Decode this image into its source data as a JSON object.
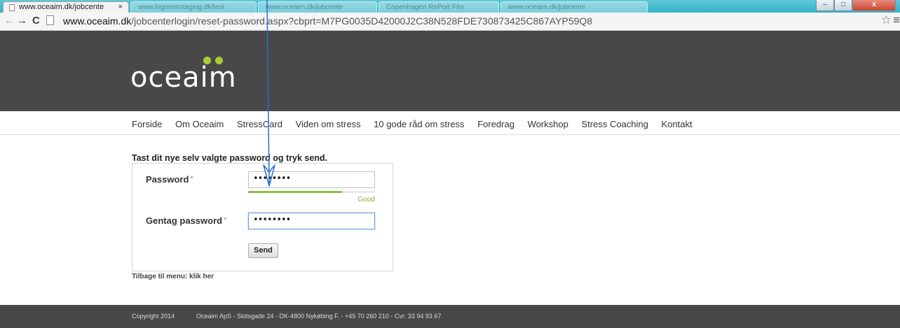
{
  "browser": {
    "active_tab": {
      "title": "www.oceaim.dk/jobcente",
      "close": "×"
    },
    "inactive_tabs": [
      {
        "title": "www.logmeinstaging.dk/test"
      },
      {
        "title": "www.oceaim.dk/jobcente"
      },
      {
        "title": "Copenhagen RePort Fitn"
      },
      {
        "title": "www.oceaim.dk/jobcente"
      }
    ],
    "url_host": "www.oceaim.dk",
    "url_rest": "/jobcenterlogin/reset-password.aspx?cbprt=M7PG0035D42000J2C38N528FDE730873425C867AYP59Q8",
    "window_controls": {
      "minimize": "–",
      "maximize": "□",
      "close": "x"
    },
    "icons": {
      "back": "arrow-left-icon",
      "forward": "arrow-right-icon",
      "reload": "reload-icon",
      "bookmark": "star-icon",
      "menu": "menu-icon"
    }
  },
  "site": {
    "logo_text": "oceaim",
    "logo_dot_color": "#aacd36",
    "header_color": "#4a4748",
    "nav": [
      "Forside",
      "Om Oceaim",
      "StressCard",
      "Viden om stress",
      "10 gode råd om stress",
      "Foredrag",
      "Workshop",
      "Stress Coaching",
      "Kontakt"
    ]
  },
  "form": {
    "instructions": "Tast dit nye selv valgte password og tryk send.",
    "password_label": "Password",
    "password_value": "••••••••",
    "required_mark": "*",
    "strength_label": "Good",
    "strength_fraction": 0.74,
    "repeat_label": "Gentag password",
    "repeat_value": "••••••••",
    "send_label": "Send"
  },
  "back_link": "Tilbage til menu: klik her",
  "footer": {
    "copyright": "Copyright 2014",
    "info": "Oceaim ApS - Slotsgade 24 - DK-4800 Nykøbing F. - +45 70 260 210 - Cvr: 33 94 93 67"
  },
  "annotation": {
    "type": "arrow",
    "color": "#2b6fd1"
  }
}
